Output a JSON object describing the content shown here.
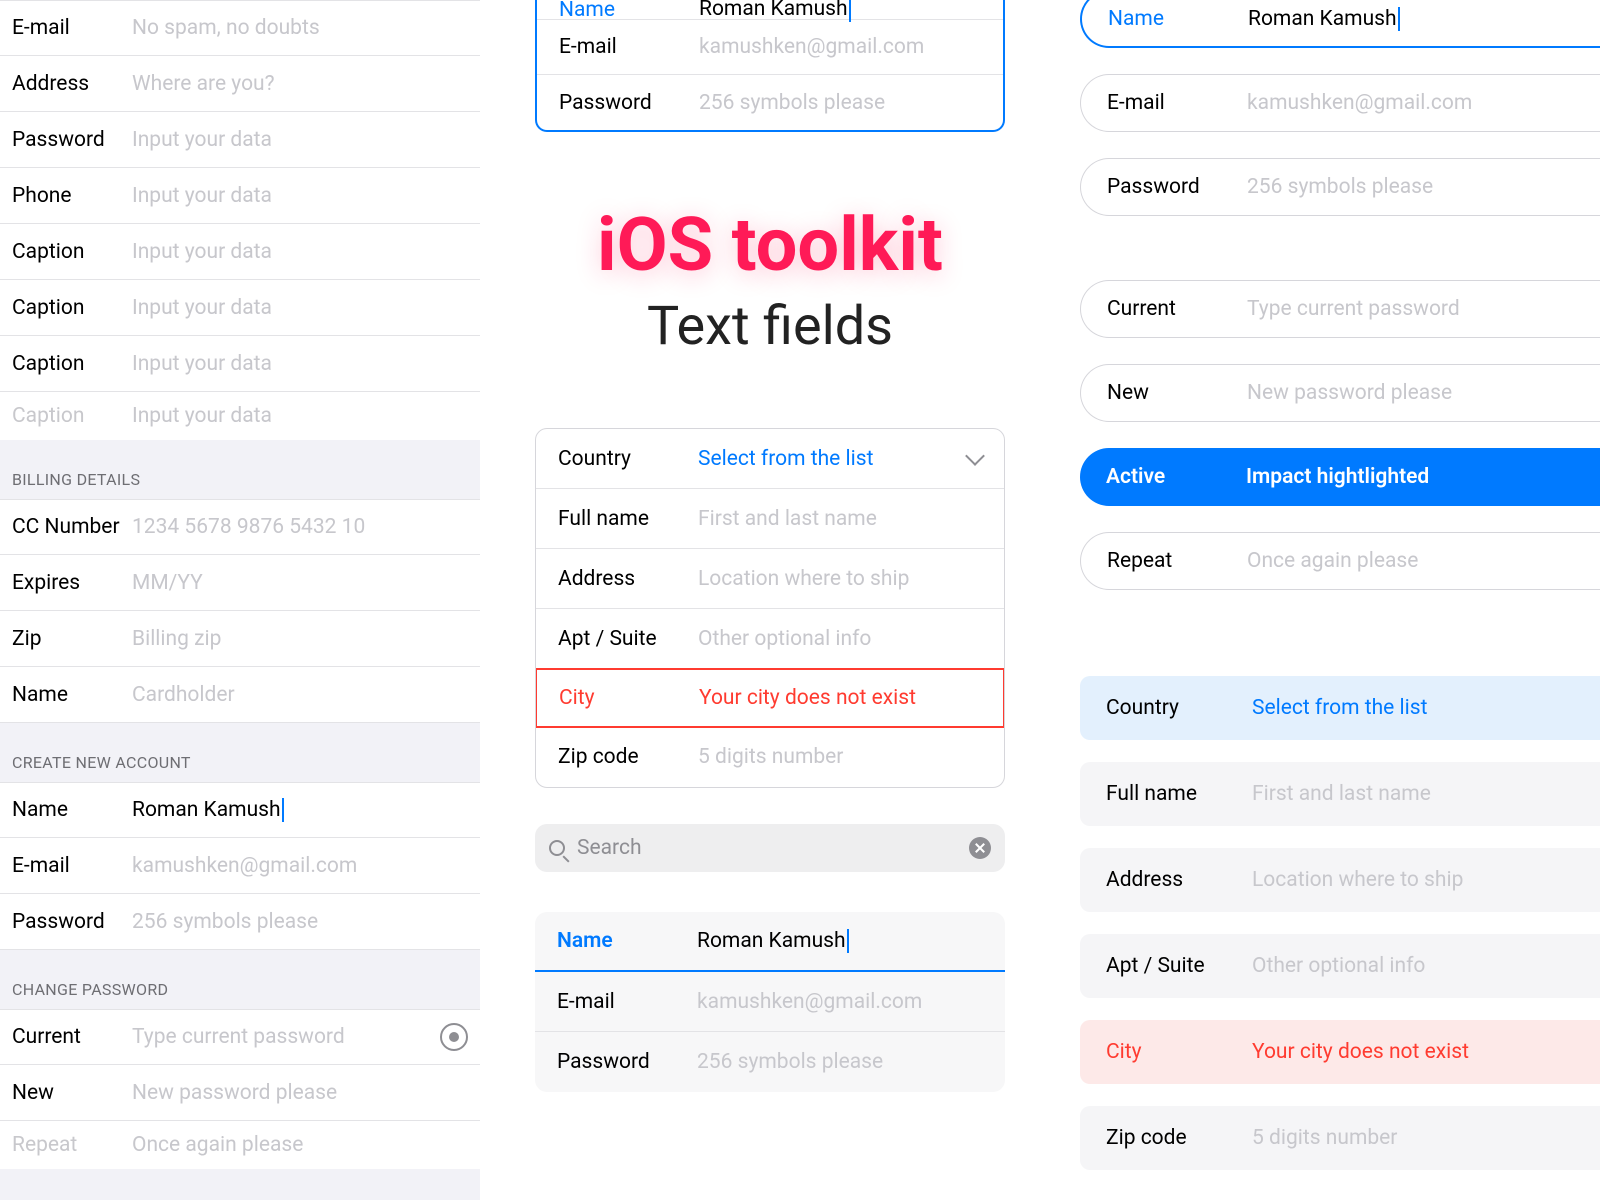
{
  "left": {
    "top_fields": [
      {
        "label": "E-mail",
        "placeholder": "No spam, no doubts"
      },
      {
        "label": "Address",
        "placeholder": "Where are you?"
      },
      {
        "label": "Password",
        "placeholder": "Input your data"
      },
      {
        "label": "Phone",
        "placeholder": "Input your data"
      },
      {
        "label": "Caption",
        "placeholder": "Input your data"
      },
      {
        "label": "Caption",
        "placeholder": "Input your data"
      },
      {
        "label": "Caption",
        "placeholder": "Input your data"
      },
      {
        "label": "Caption",
        "placeholder": "Input your data"
      }
    ],
    "billing_header": "BILLING DETAILS",
    "billing": [
      {
        "label": "CC Number",
        "placeholder": "1234 5678 9876 5432 10"
      },
      {
        "label": "Expires",
        "placeholder": "MM/YY"
      },
      {
        "label": "Zip",
        "placeholder": "Billing zip"
      },
      {
        "label": "Name",
        "placeholder": "Cardholder"
      }
    ],
    "create_header": "CREATE NEW ACCOUNT",
    "create": [
      {
        "label": "Name",
        "value": "Roman Kamush"
      },
      {
        "label": "E-mail",
        "placeholder": "kamushken@gmail.com"
      },
      {
        "label": "Password",
        "placeholder": "256 symbols please"
      }
    ],
    "change_header": "CHANGE PASSWORD",
    "change": [
      {
        "label": "Current",
        "placeholder": "Type current password",
        "eye": true
      },
      {
        "label": "New",
        "placeholder": "New password please"
      },
      {
        "label": "Repeat",
        "placeholder": "Once again please"
      }
    ]
  },
  "mid": {
    "top_card": [
      {
        "label": "Name",
        "value": "Roman Kamush",
        "active": true
      },
      {
        "label": "E-mail",
        "placeholder": "kamushken@gmail.com"
      },
      {
        "label": "Password",
        "placeholder": "256 symbols please"
      }
    ],
    "title": "iOS toolkit",
    "subtitle": "Text fields",
    "shipping": [
      {
        "label": "Country",
        "link": "Select from the list",
        "chevron": true
      },
      {
        "label": "Full name",
        "placeholder": "First and last name"
      },
      {
        "label": "Address",
        "placeholder": "Location where to ship"
      },
      {
        "label": "Apt / Suite",
        "placeholder": "Other optional info"
      },
      {
        "label": "City",
        "error": "Your city does not exist"
      },
      {
        "label": "Zip code",
        "placeholder": "5 digits number"
      }
    ],
    "search_placeholder": "Search",
    "bottom_card": [
      {
        "label": "Name",
        "value": "Roman Kamush",
        "active": true
      },
      {
        "label": "E-mail",
        "placeholder": "kamushken@gmail.com"
      },
      {
        "label": "Password",
        "placeholder": "256 symbols please"
      }
    ]
  },
  "right": {
    "pills_account": [
      {
        "label": "Name",
        "value": "Roman Kamush",
        "active": true
      },
      {
        "label": "E-mail",
        "placeholder": "kamushken@gmail.com"
      },
      {
        "label": "Password",
        "placeholder": "256 symbols please"
      }
    ],
    "pills_password": [
      {
        "label": "Current",
        "placeholder": "Type current password"
      },
      {
        "label": "New",
        "placeholder": "New password please"
      },
      {
        "label": "Active",
        "value": "Impact hightlighted",
        "solid": true
      },
      {
        "label": "Repeat",
        "placeholder": "Once again please"
      }
    ],
    "blocks": [
      {
        "label": "Country",
        "link": "Select from the list",
        "sel": true
      },
      {
        "label": "Full name",
        "placeholder": "First and last name"
      },
      {
        "label": "Address",
        "placeholder": "Location where to ship"
      },
      {
        "label": "Apt / Suite",
        "placeholder": "Other optional info"
      },
      {
        "label": "City",
        "error": "Your city does not exist"
      },
      {
        "label": "Zip code",
        "placeholder": "5 digits number"
      }
    ]
  }
}
